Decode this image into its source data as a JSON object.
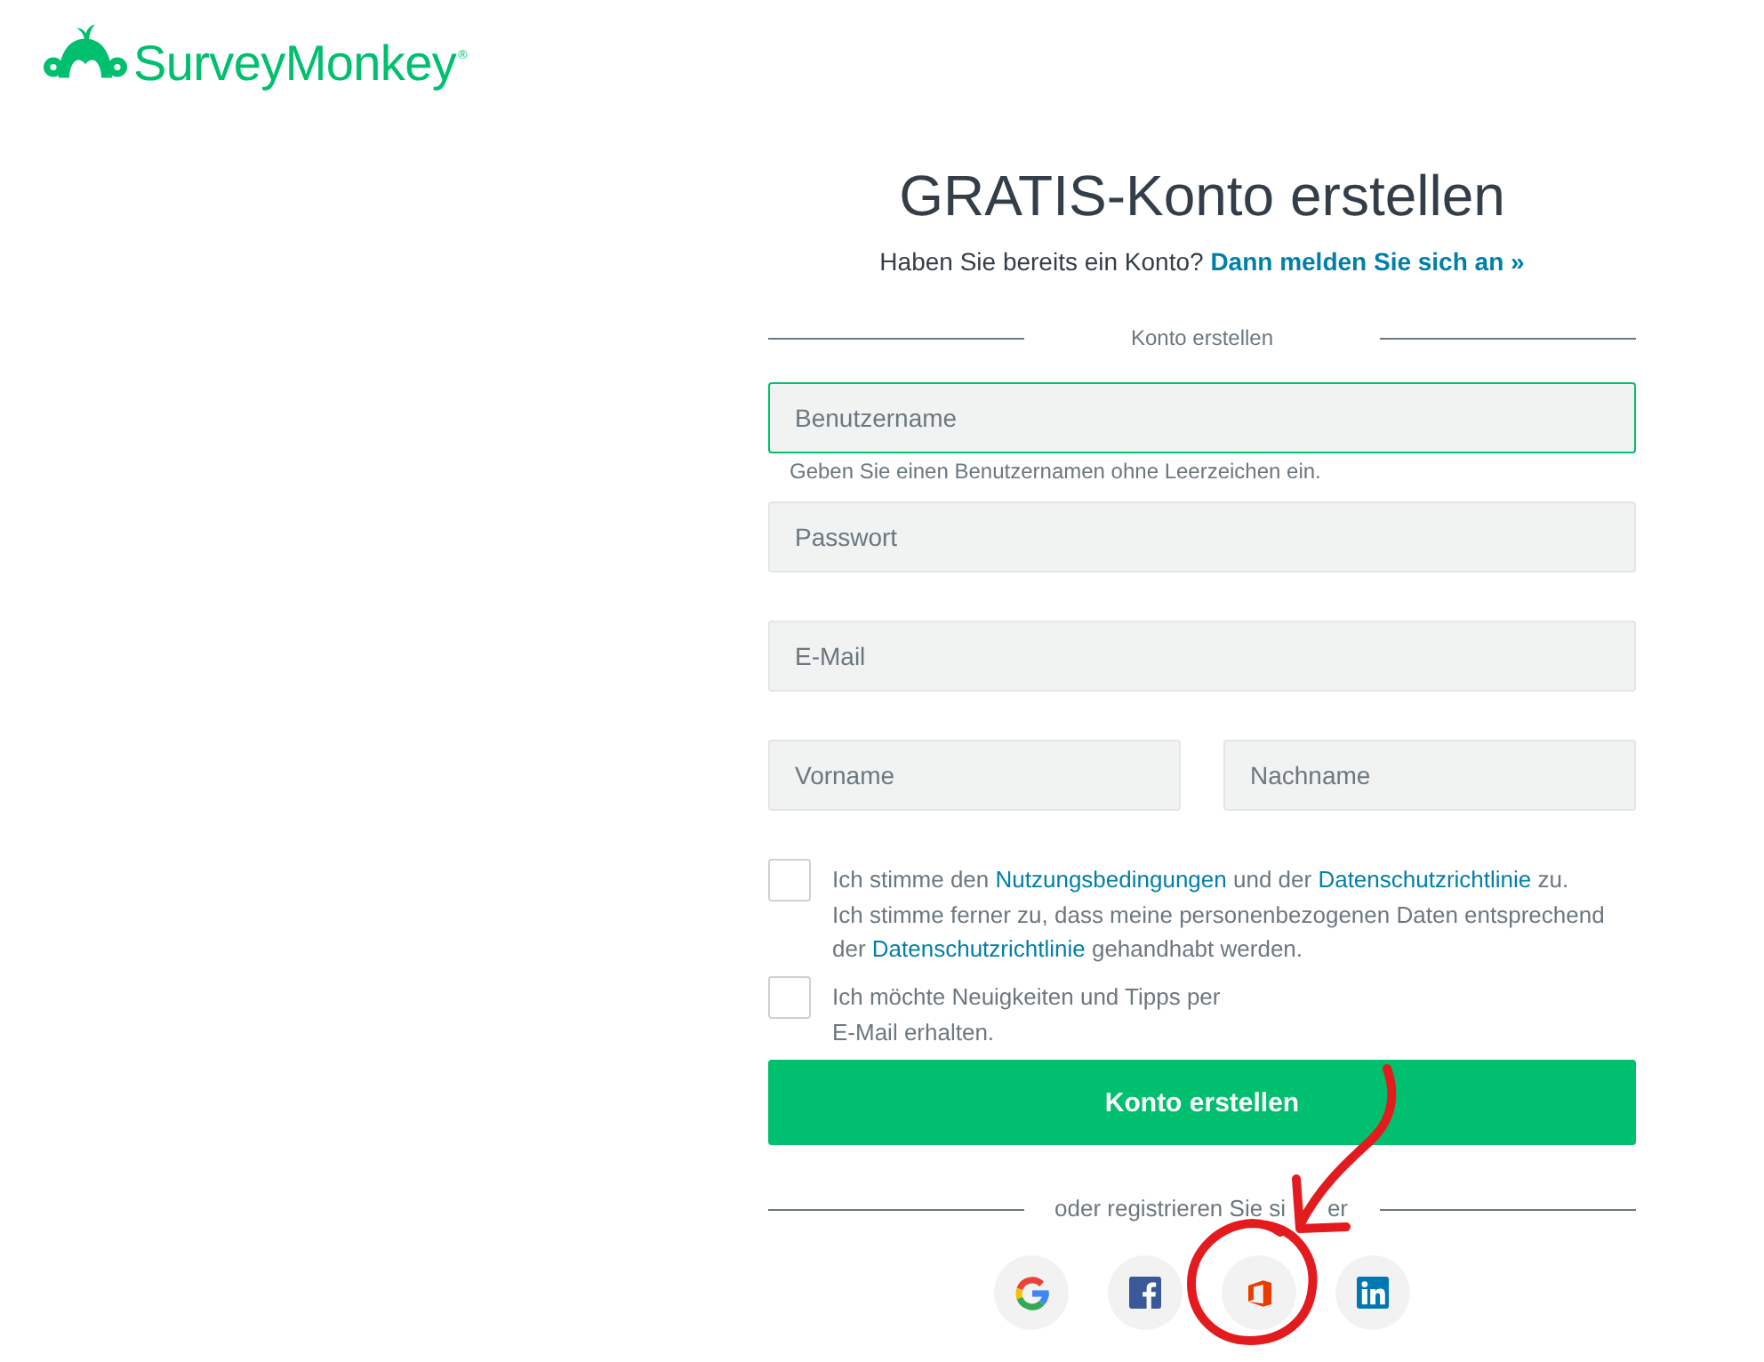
{
  "logo": {
    "wordmark": "SurveyMonkey$^{®}$"
  },
  "title": "GRATIS-Konto erstellen",
  "login_prompt": {
    "text": "Haben Sie bereits ein Konto?",
    "link": "Dann melden Sie sich an »"
  },
  "form": {
    "section_label": "Konto erstellen",
    "fields": [
      {
        "placeholder": "Benutzername",
        "focused": true,
        "hint": "Geben Sie einen Benutzernamen ohne Leerzeichen ein."
      },
      {
        "placeholder": "Passwort",
        "focused": false
      },
      {
        "placeholder": "E-Mail",
        "focused": false
      }
    ],
    "name_fields": [
      {
        "placeholder": "Vorname",
        "focused": false
      },
      {
        "placeholder": "Nachname",
        "focused": false
      }
    ],
    "checkboxes": [
      {
        "checked": false,
        "paragraphs": [
          [
            {
              "kind": "text",
              "text": "Ich stimme den "
            },
            {
              "kind": "link",
              "text": "Nutzungsbedingungen"
            },
            {
              "kind": "text",
              "text": " und der "
            },
            {
              "kind": "link",
              "text": "Datenschutzrichtlinie"
            },
            {
              "kind": "text",
              "text": " zu."
            }
          ],
          [
            {
              "kind": "text",
              "text": "Ich stimme ferner zu, dass meine personenbezogenen Daten entsprechend der "
            },
            {
              "kind": "link",
              "text": "Datenschutzrichtlinie"
            },
            {
              "kind": "text",
              "text": " gehandhabt werden."
            }
          ]
        ]
      },
      {
        "checked": false,
        "paragraphs": [
          [
            {
              "kind": "text",
              "text": "Ich möchte Neuigkeiten und Tipps per E-Mail erhalten."
            }
          ]
        ]
      }
    ],
    "submit_button": "Konto erstellen",
    "social_label": {
      "visible_start": "oder registrieren Sie si",
      "visible_end": "er"
    },
    "social_buttons": [
      {
        "kind": "google"
      },
      {
        "kind": "facebook"
      },
      {
        "kind": "office"
      },
      {
        "kind": "linkedin"
      }
    ]
  },
  "annotations": {
    "arrow": true,
    "circle": true
  }
}
